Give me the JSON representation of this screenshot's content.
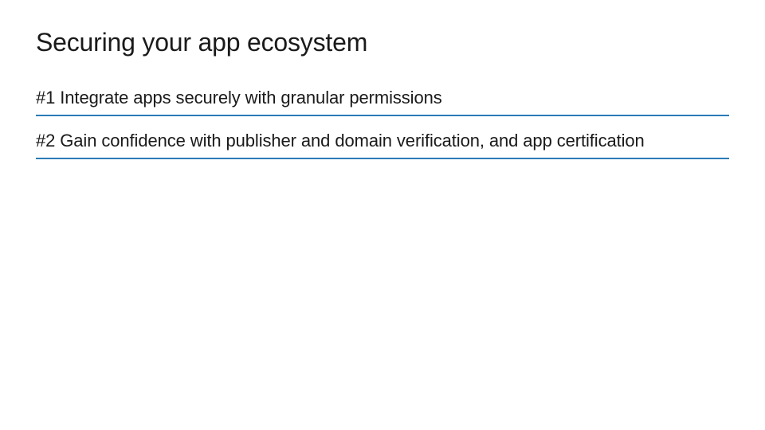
{
  "slide": {
    "title": "Securing your app ecosystem",
    "items": [
      "#1 Integrate apps securely with granular permissions",
      "#2 Gain confidence with publisher and domain verification, and app certification"
    ],
    "accent_color": "#2a7cb8"
  }
}
